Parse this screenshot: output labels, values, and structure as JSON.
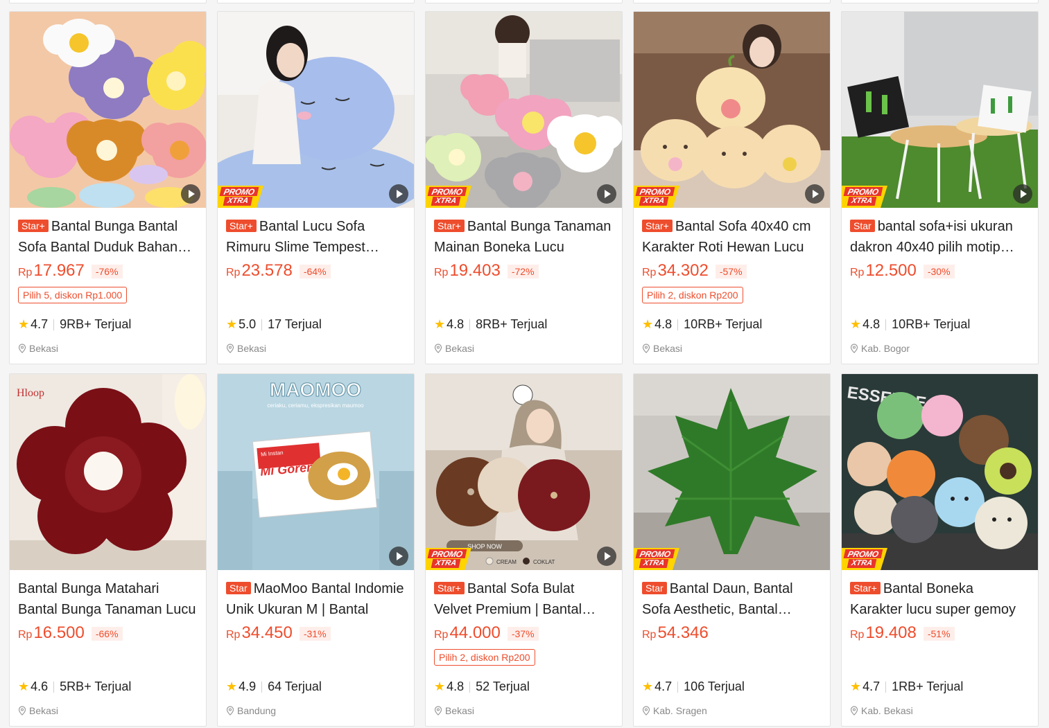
{
  "currency": "Rp",
  "colors": {
    "accent": "#ee4d2d",
    "star": "#ffbf00",
    "promo_yellow": "#ffd400"
  },
  "icons": {
    "play": "play-icon",
    "star": "star-icon",
    "location": "location-pin-icon"
  },
  "products": [
    {
      "badge": "Star+",
      "title": "Bantal Bunga Bantal Sofa Bantal Duduk Bahan Lembut",
      "price": "17.967",
      "discount": "-76%",
      "promo": "Pilih 5, diskon Rp1.000",
      "rating": "4.7",
      "sold": "9RB+ Terjual",
      "location": "Bekasi",
      "promo_xtra": false,
      "video": true
    },
    {
      "badge": "Star+",
      "title": "Bantal Lucu Sofa Rimuru Slime Tempest Bantal Boneka",
      "price": "23.578",
      "discount": "-64%",
      "promo": "",
      "rating": "5.0",
      "sold": "17 Terjual",
      "location": "Bekasi",
      "promo_xtra": true,
      "video": true
    },
    {
      "badge": "Star+",
      "title": "Bantal Bunga Tanaman Mainan Boneka Lucu",
      "price": "19.403",
      "discount": "-72%",
      "promo": "",
      "rating": "4.8",
      "sold": "8RB+ Terjual",
      "location": "Bekasi",
      "promo_xtra": true,
      "video": true
    },
    {
      "badge": "Star+",
      "title": "Bantal Sofa 40x40 cm Karakter Roti Hewan Lucu",
      "price": "34.302",
      "discount": "-57%",
      "promo": "Pilih 2, diskon Rp200",
      "rating": "4.8",
      "sold": "10RB+ Terjual",
      "location": "Bekasi",
      "promo_xtra": true,
      "video": true
    },
    {
      "badge": "Star",
      "title": "bantal sofa+isi ukuran dakron 40x40 pilih motip kaktus",
      "price": "12.500",
      "discount": "-30%",
      "promo": "",
      "rating": "4.8",
      "sold": "10RB+ Terjual",
      "location": "Kab. Bogor",
      "promo_xtra": true,
      "video": true
    },
    {
      "badge": "",
      "title": "Bantal Bunga Matahari Bantal Bunga Tanaman Lucu",
      "price": "16.500",
      "discount": "-66%",
      "promo": "",
      "rating": "4.6",
      "sold": "5RB+ Terjual",
      "location": "Bekasi",
      "promo_xtra": false,
      "video": false
    },
    {
      "badge": "Star",
      "title": "MaoMoo Bantal Indomie Unik Ukuran M | Bantal",
      "price": "34.450",
      "discount": "-31%",
      "promo": "",
      "rating": "4.9",
      "sold": "64 Terjual",
      "location": "Bandung",
      "promo_xtra": false,
      "video": true
    },
    {
      "badge": "Star+",
      "title": "Bantal Sofa Bulat Velvet Premium | Bantal Dekorasi",
      "price": "44.000",
      "discount": "-37%",
      "promo": "Pilih 2, diskon Rp200",
      "rating": "4.8",
      "sold": "52 Terjual",
      "location": "Bekasi",
      "promo_xtra": true,
      "video": true
    },
    {
      "badge": "Star",
      "title": "Bantal Daun, Bantal Sofa Aesthetic, Bantal Dekorasi",
      "price": "54.346",
      "discount": "",
      "promo": "",
      "rating": "4.7",
      "sold": "106 Terjual",
      "location": "Kab. Sragen",
      "promo_xtra": true,
      "video": false
    },
    {
      "badge": "Star+",
      "title": "Bantal Boneka Karakter lucu super gemoy",
      "price": "19.408",
      "discount": "-51%",
      "promo": "",
      "rating": "4.7",
      "sold": "1RB+ Terjual",
      "location": "Kab. Bekasi",
      "promo_xtra": true,
      "video": false
    }
  ],
  "image_text": {
    "hloop": "Hloop",
    "maomoo": "MAOMOO",
    "maomoo_sub": "ceriaku, ceriamu, ekspresikan maumoo",
    "mi_instan": "Mi Instan",
    "mi_goreng": "Mi Goreng",
    "shop_now": "SHOP NOW",
    "cream": "CREAM",
    "coklat": "COKLAT",
    "essence": "ESSENCE",
    "promo_line1": "PROMO",
    "promo_line2": "XTRA"
  }
}
